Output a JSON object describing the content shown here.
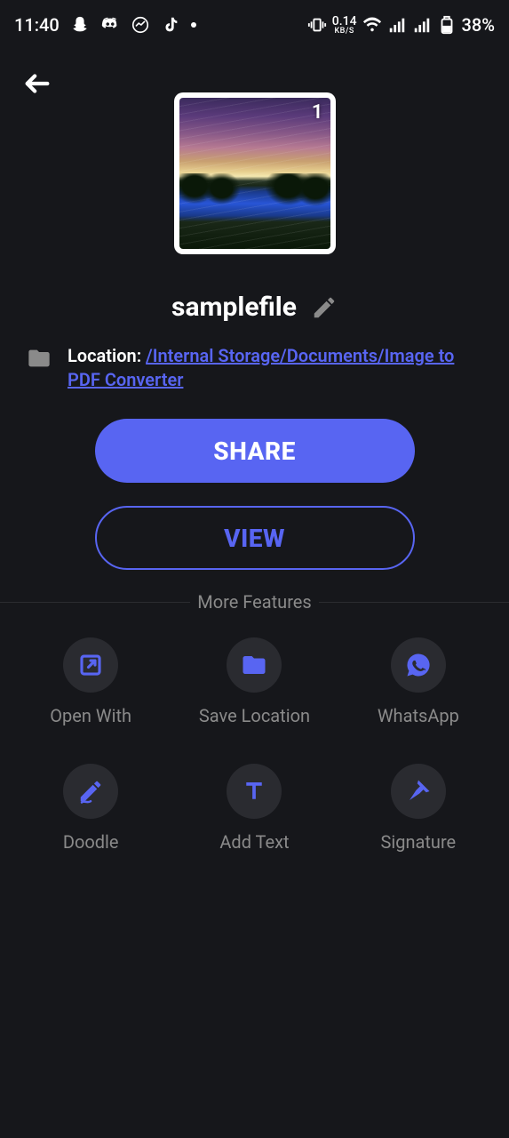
{
  "status": {
    "time": "11:40",
    "kbs_value": "0.14",
    "kbs_label": "KB/S",
    "battery": "38%"
  },
  "preview": {
    "count": "1"
  },
  "file": {
    "name": "samplefile"
  },
  "location": {
    "label": "Location: ",
    "path": "/Internal Storage/Documents/Image to PDF Converter"
  },
  "buttons": {
    "share": "SHARE",
    "view": "VIEW"
  },
  "more_features_label": "More Features",
  "features": [
    {
      "label": "Open With"
    },
    {
      "label": "Save Location"
    },
    {
      "label": "WhatsApp"
    },
    {
      "label": "Doodle"
    },
    {
      "label": "Add Text"
    },
    {
      "label": "Signature"
    }
  ]
}
